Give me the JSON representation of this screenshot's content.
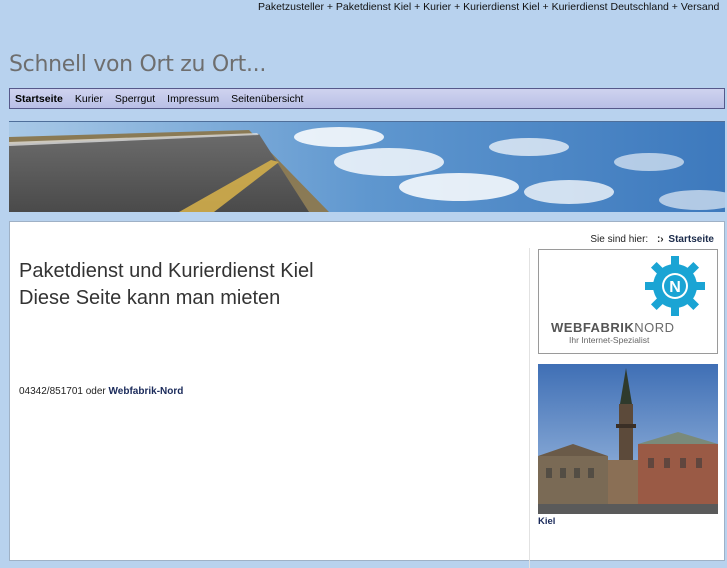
{
  "topline": "Paketzusteller + Paketdienst Kiel + Kurier + Kurierdienst Kiel + Kurierdienst Deutschland + Versand",
  "site_title": "Schnell von Ort zu Ort...",
  "nav": {
    "items": [
      "Startseite",
      "Kurier",
      "Sperrgut",
      "Impressum",
      "Seitenübersicht"
    ],
    "active": "Startseite"
  },
  "breadcrumb": {
    "prefix": "Sie sind hier:",
    "arrow": ":›",
    "current": "Startseite"
  },
  "main": {
    "headline_line1": "Paketdienst und Kurierdienst Kiel",
    "headline_line2": "Diese Seite kann man mieten",
    "contact_phone": "04342/851701 oder",
    "contact_link": "Webfabrik-Nord"
  },
  "sidebar": {
    "ad_brand_bold": "WEBFABRIK",
    "ad_brand_light": "NORD",
    "ad_tagline": "Ihr Internet-Spezialist",
    "ad_logo_letter": "N",
    "photo_caption": "Kiel"
  },
  "colors": {
    "page_bg": "#b8d2ee",
    "nav_border": "#56598a",
    "gear": "#1aa4d4"
  }
}
